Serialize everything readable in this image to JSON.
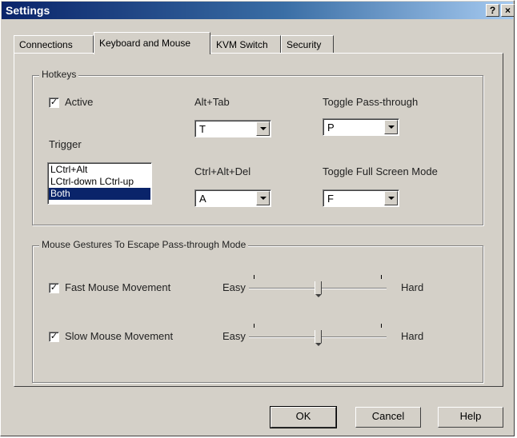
{
  "window": {
    "title": "Settings",
    "help_glyph": "?",
    "close_glyph": "×"
  },
  "tabs": [
    {
      "label": "Connections",
      "active": false
    },
    {
      "label": "Keyboard and Mouse",
      "active": true
    },
    {
      "label": "KVM Switch",
      "active": false
    },
    {
      "label": "Security",
      "active": false
    }
  ],
  "hotkeys": {
    "title": "Hotkeys",
    "active_label": "Active",
    "active_checked": true,
    "trigger_label": "Trigger",
    "trigger_options": [
      "LCtrl+Alt",
      "LCtrl-down LCtrl-up",
      "Both"
    ],
    "trigger_selected": 2,
    "alt_tab_label": "Alt+Tab",
    "alt_tab_value": "T",
    "ctrl_alt_del_label": "Ctrl+Alt+Del",
    "ctrl_alt_del_value": "A",
    "toggle_pass_label": "Toggle Pass-through",
    "toggle_pass_value": "P",
    "toggle_full_label": "Toggle Full Screen Mode",
    "toggle_full_value": "F"
  },
  "mouse": {
    "title": "Mouse Gestures To Escape Pass-through Mode",
    "fast": {
      "label": "Fast Mouse Movement",
      "checked": true,
      "easy": "Easy",
      "hard": "Hard",
      "level": 0.5
    },
    "slow": {
      "label": "Slow Mouse Movement",
      "checked": true,
      "easy": "Easy",
      "hard": "Hard",
      "level": 0.5
    }
  },
  "buttons": {
    "ok": "OK",
    "cancel": "Cancel",
    "help": "Help"
  },
  "check_glyph": "✓",
  "colors": {
    "selection": "#0a246a",
    "face": "#d4d0c8"
  }
}
